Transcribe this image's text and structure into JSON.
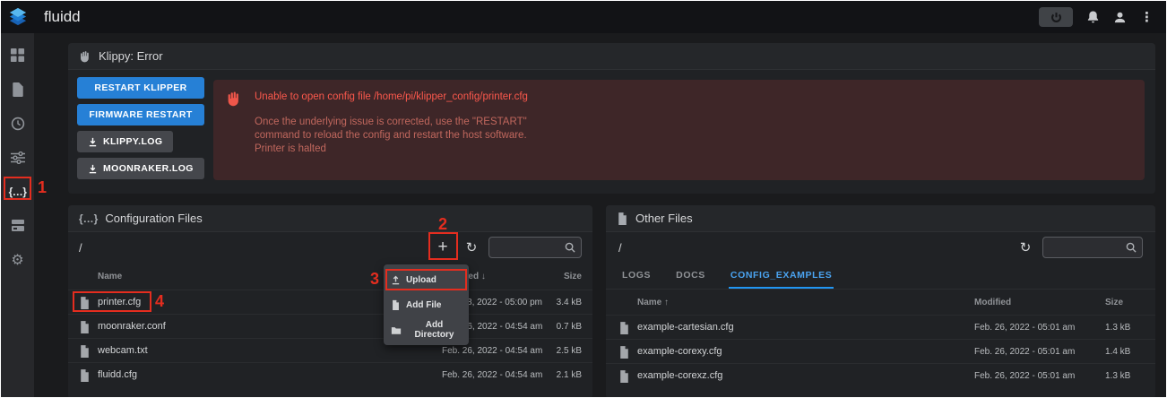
{
  "colors": {
    "accent": "#2196f3",
    "error": "#fb584c",
    "annotation": "#e42d1f"
  },
  "icons": {
    "braces": "{…}",
    "plus": "+",
    "refresh": "↻",
    "kebab": "⋮",
    "gear": "⚙"
  },
  "topbar": {
    "title": "fluidd"
  },
  "sidebar": {
    "items": [
      {
        "name": "dashboard"
      },
      {
        "name": "jobs"
      },
      {
        "name": "history"
      },
      {
        "name": "tune"
      },
      {
        "name": "configure",
        "active": true
      },
      {
        "name": "printer"
      },
      {
        "name": "settings"
      }
    ]
  },
  "klippy": {
    "title": "Klippy: Error",
    "buttons": {
      "restart_klipper": "RESTART KLIPPER",
      "firmware_restart": "FIRMWARE RESTART",
      "klippy_log": "KLIPPY.LOG",
      "moonraker_log": "MOONRAKER.LOG"
    },
    "error": {
      "line1": "Unable to open config file /home/pi/klipper_config/printer.cfg",
      "line2": "Once the underlying issue is corrected, use the \"RESTART\"",
      "line3": "command to reload the config and restart the host software.",
      "line4": "Printer is halted"
    }
  },
  "config_files": {
    "title": "Configuration Files",
    "path": "/",
    "columns": {
      "name": "Name",
      "modified": "Modified ↓",
      "size": "Size"
    },
    "rows": [
      {
        "name": "printer.cfg",
        "modified": "Mar. 08, 2022 - 05:00 pm",
        "size": "3.4 kB"
      },
      {
        "name": "moonraker.conf",
        "modified": "Feb. 26, 2022 - 04:54 am",
        "size": "0.7 kB"
      },
      {
        "name": "webcam.txt",
        "modified": "Feb. 26, 2022 - 04:54 am",
        "size": "2.5 kB"
      },
      {
        "name": "fluidd.cfg",
        "modified": "Feb. 26, 2022 - 04:54 am",
        "size": "2.1 kB"
      }
    ],
    "menu": {
      "upload": "Upload",
      "add_file": "Add File",
      "add_directory": "Add Directory"
    }
  },
  "other_files": {
    "title": "Other Files",
    "path": "/",
    "tabs": [
      "LOGS",
      "DOCS",
      "CONFIG_EXAMPLES"
    ],
    "active_tab": "CONFIG_EXAMPLES",
    "columns": {
      "name": "Name ↑",
      "modified": "Modified",
      "size": "Size"
    },
    "rows": [
      {
        "name": "example-cartesian.cfg",
        "modified": "Feb. 26, 2022 - 05:01 am",
        "size": "1.3 kB"
      },
      {
        "name": "example-corexy.cfg",
        "modified": "Feb. 26, 2022 - 05:01 am",
        "size": "1.4 kB"
      },
      {
        "name": "example-corexz.cfg",
        "modified": "Feb. 26, 2022 - 05:01 am",
        "size": "1.3 kB"
      }
    ]
  },
  "annotations": {
    "step1": "1",
    "step2": "2",
    "step3": "3",
    "step4": "4"
  }
}
